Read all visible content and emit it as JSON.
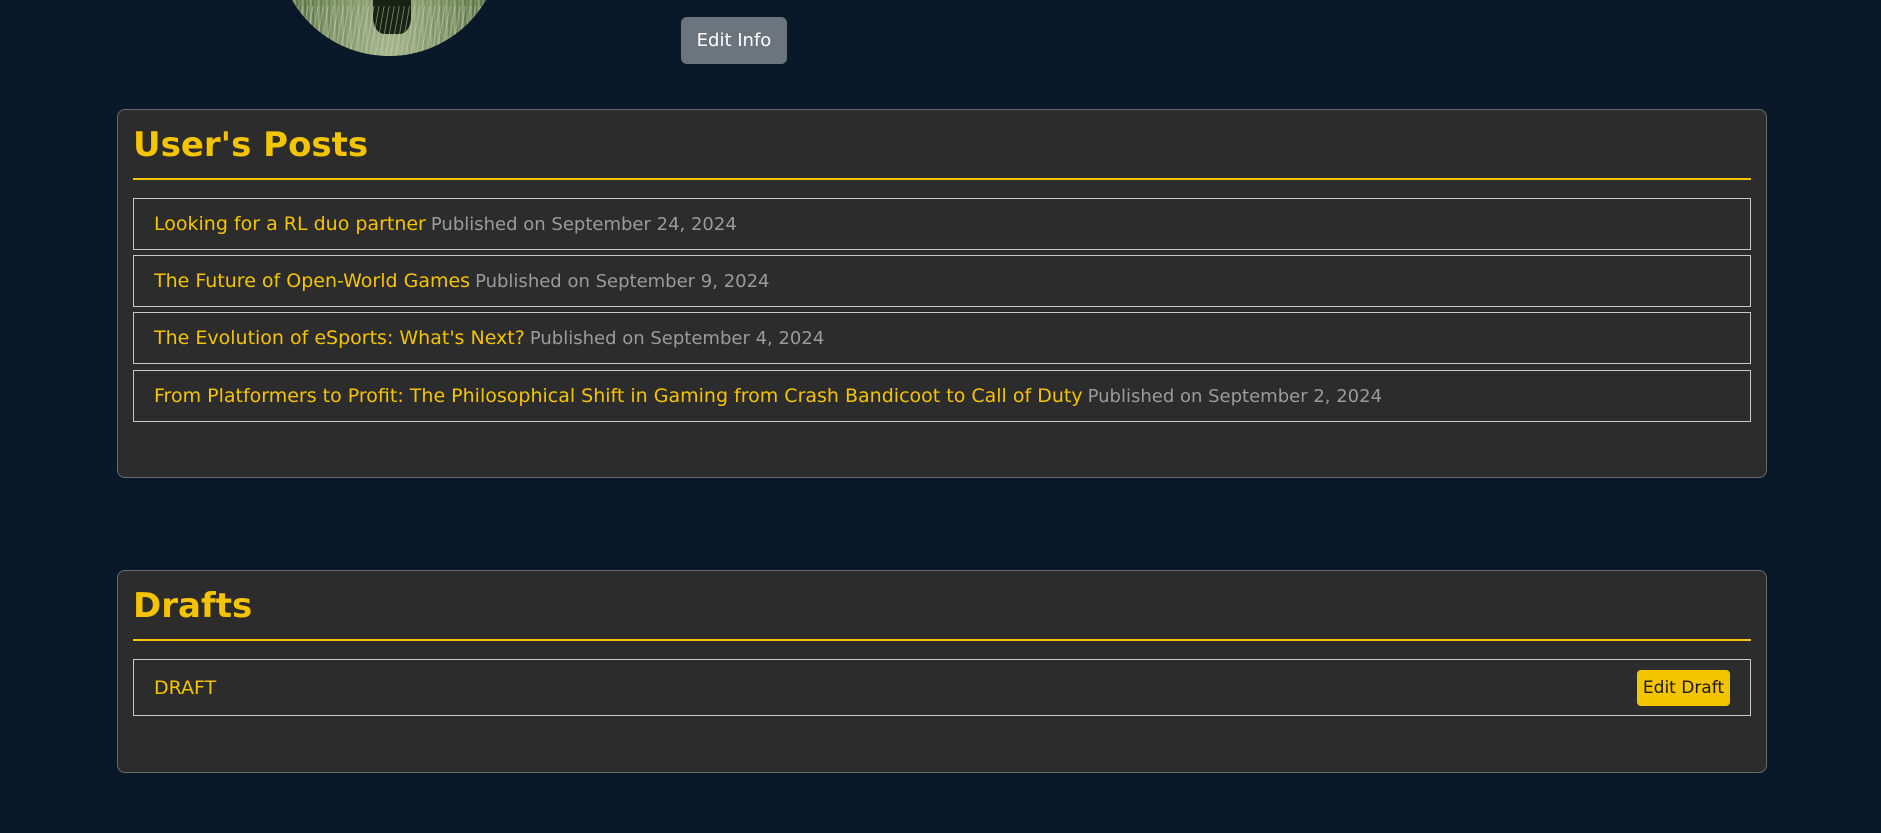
{
  "profile": {
    "avatar_alt": "",
    "edit_info_label": "Edit Info"
  },
  "posts_section": {
    "title": "User's Posts",
    "posts": [
      {
        "title": "Looking for a RL duo partner",
        "date_text": "Published on September 24, 2024"
      },
      {
        "title": "The Future of Open-World Games",
        "date_text": "Published on September 9, 2024"
      },
      {
        "title": "The Evolution of eSports: What's Next?",
        "date_text": "Published on September 4, 2024"
      },
      {
        "title": "From Platformers to Profit: The Philosophical Shift in Gaming from Crash Bandicoot to Call of Duty",
        "date_text": "Published on September 2, 2024"
      }
    ]
  },
  "drafts_section": {
    "title": "Drafts",
    "drafts": [
      {
        "title": "DRAFT",
        "edit_label": "Edit Draft"
      }
    ]
  },
  "colors": {
    "page_background": "#0a1929",
    "card_background": "#2c2c2c",
    "accent": "#f5c400",
    "muted_text": "#9b9b9b",
    "secondary_button": "#6c757d"
  }
}
